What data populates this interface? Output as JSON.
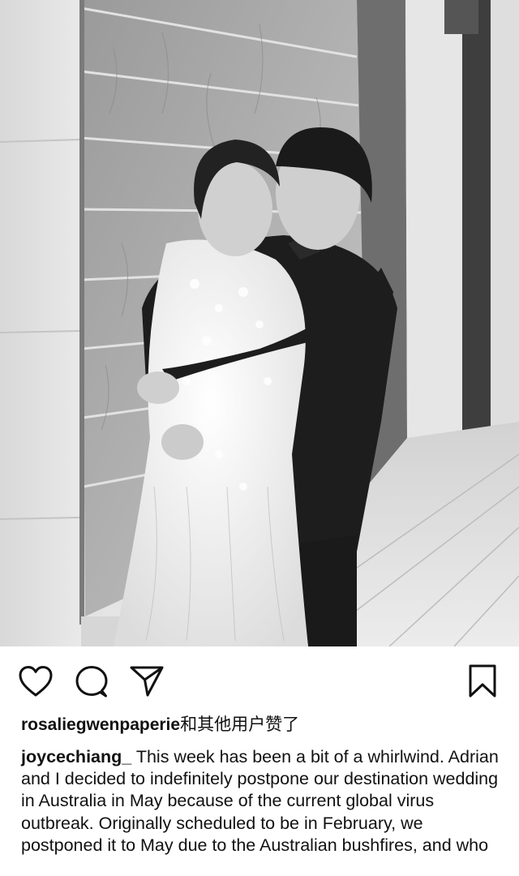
{
  "post": {
    "liked_by_user": "rosaliegwenpaperie",
    "liked_by_suffix": "和其他用户赞了",
    "caption_user": "joycechiang_",
    "caption_text": "This week has been a bit of a whirlwind. Adrian and I decided to indefinitely postpone our destination wedding in Australia in May because of the current global virus outbreak. Originally scheduled to be in February, we postponed it to May due to the Australian bushfires, and who"
  },
  "actions": {
    "like_icon": "heart-icon",
    "comment_icon": "speech-bubble-icon",
    "share_icon": "paper-plane-icon",
    "save_icon": "bookmark-icon"
  },
  "colors": {
    "icon_stroke": "#111111",
    "text": "#111111",
    "background": "#ffffff"
  }
}
